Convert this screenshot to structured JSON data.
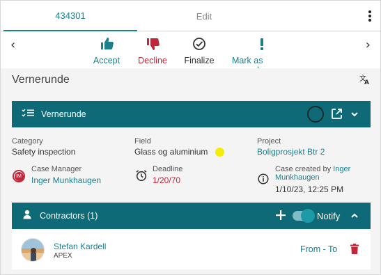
{
  "tabs": [
    {
      "label": "434301",
      "active": true
    },
    {
      "label": "Edit",
      "active": false
    }
  ],
  "actions": {
    "accept": "Accept",
    "decline": "Decline",
    "finalize": "Finalize",
    "mark_unread": "Mark as unread"
  },
  "page_title": "Vernerunde",
  "panel": {
    "title": "Vernerunde",
    "category_label": "Category",
    "category_value": "Safety inspection",
    "field_label": "Field",
    "field_value": "Glass og aluminium",
    "project_label": "Project",
    "project_value": "Boligprosjekt Btr 2",
    "manager_label": "Case Manager",
    "manager_initials": "IM",
    "manager_name": "Inger Munkhaugen",
    "deadline_label": "Deadline",
    "deadline_value": "1/20/70",
    "created_label": "Case created by",
    "created_by_first": "Inger",
    "created_by_last": "Munkhaugen",
    "created_at": "1/10/23, 12:25 PM"
  },
  "contractors": {
    "title": "Contractors (1)",
    "notify_label": "Notify",
    "notify_on": true,
    "items": [
      {
        "name": "Stefan Kardell",
        "company": "APEX",
        "range": "From - To"
      }
    ]
  },
  "colors": {
    "accent": "#1c7f8c",
    "panel_header": "#0d6a76",
    "decline": "#c1273a",
    "deadline": "#c1273a",
    "highlight_dot": "#f2ee06"
  }
}
